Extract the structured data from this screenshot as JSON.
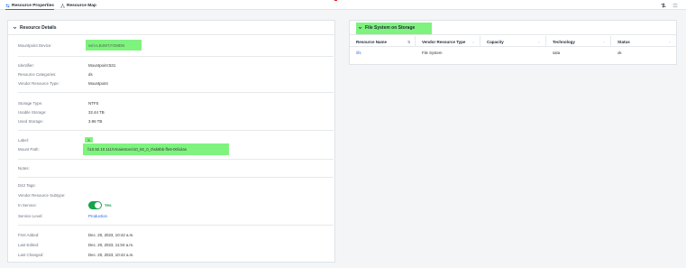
{
  "tabs": [
    {
      "label": "Resource Properties",
      "icon": "sliders-icon",
      "active": true
    },
    {
      "label": "Resource Map",
      "icon": "topology-icon",
      "active": false
    }
  ],
  "toolbar": {
    "icons": [
      "split-view-icon",
      "list-view-icon"
    ]
  },
  "resource_details": {
    "title": "Resource Details",
    "mountpoint_device_label": "Mountpoint Device:",
    "mountpoint_device_value": "svm-LB4WT.FOMDN",
    "identifier_label": "Identifier:",
    "identifier_value": "Mountpoint:531",
    "resource_categories_label": "Resource Categories:",
    "resource_categories_value": "ds",
    "vendor_resource_type_label": "Vendor Resource Type:",
    "vendor_resource_type_value": "Mountpoint",
    "storage_type_label": "Storage Type:",
    "storage_type_value": "NTFS",
    "usable_storage_label": "Usable Storage:",
    "usable_storage_value": "32.44 TB",
    "used_storage_label": "Used Storage:",
    "used_storage_value": "3.96 TB",
    "label_label": "Label:",
    "label_value": "X",
    "mount_path_label": "Mount Path:",
    "mount_path_value": "\\\\10.92.10.111\\Vmainstore\\10_92_0_0\\sk8bb-ffe8-00\\iolan",
    "notes_label": "Notes:",
    "d42_tags_label": "D42 Tags:",
    "vendor_resource_subtype_label": "Vendor Resource Subtype:",
    "in_service_label": "In Service:",
    "in_service_value": "Yes",
    "service_level_label": "Service Level:",
    "service_level_value": "Production",
    "first_added_label": "First Added:",
    "first_added_value": "Dec. 20, 2023, 10:42 a.m.",
    "last_edited_label": "Last Edited:",
    "last_edited_value": "Dec. 20, 2023, 11:04 a.m.",
    "last_changed_label": "Last Changed:",
    "last_changed_value": "Dec. 20, 2023, 10:42 a.m."
  },
  "file_system": {
    "title": "File System on Storage",
    "columns": [
      "Resource Name",
      "Vendor Resource Type",
      "Capacity",
      "Technology",
      "Status"
    ],
    "rows": [
      {
        "resource_name": "/ifs",
        "vendor_resource_type": "File System",
        "capacity": "",
        "technology": "sata",
        "status": "ok"
      }
    ]
  },
  "colors": {
    "accent": "#2563eb",
    "highlight": "#7ef37e",
    "toggle_on": "#16a34a"
  }
}
